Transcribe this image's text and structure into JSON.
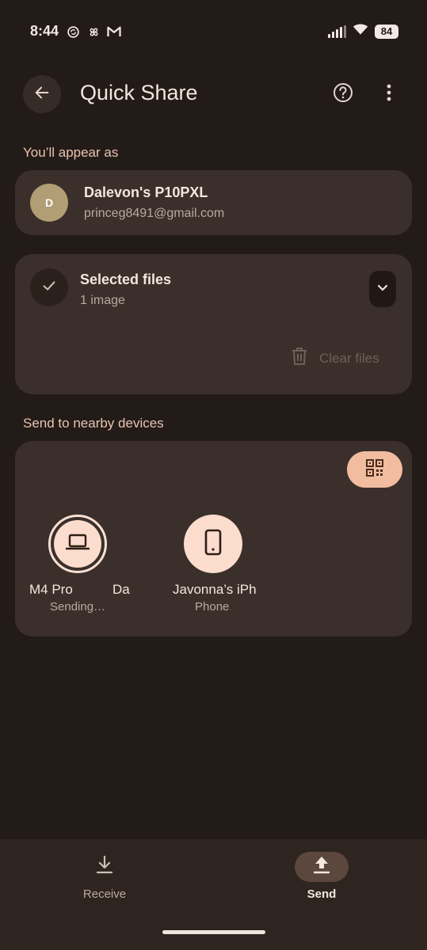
{
  "status_bar": {
    "time": "8:44",
    "battery": "84",
    "left_icons": [
      "sync-icon",
      "pinwheel-icon",
      "gmail-icon"
    ]
  },
  "header": {
    "title": "Quick Share"
  },
  "appear_as": {
    "label": "You’ll appear as",
    "avatar_text": "D",
    "device_name": "Dalevon's P10PXL",
    "email": "princeg8491@gmail.com"
  },
  "files": {
    "title": "Selected files",
    "subtitle": "1 image",
    "clear_label": "Clear files"
  },
  "nearby": {
    "label": "Send to nearby devices",
    "devices": [
      {
        "name": "M4 Pro",
        "name_extra": "Da",
        "status": "Sending…",
        "icon": "laptop-icon"
      },
      {
        "name": "Javonna’s iPh",
        "status": "Phone",
        "icon": "phone-icon"
      }
    ]
  },
  "bottom_nav": {
    "receive_label": "Receive",
    "send_label": "Send",
    "active": "send"
  },
  "colors": {
    "background": "#231b17",
    "card": "#3a2f2b",
    "accent": "#f1bc9f",
    "device_circle": "#fbdccd"
  }
}
